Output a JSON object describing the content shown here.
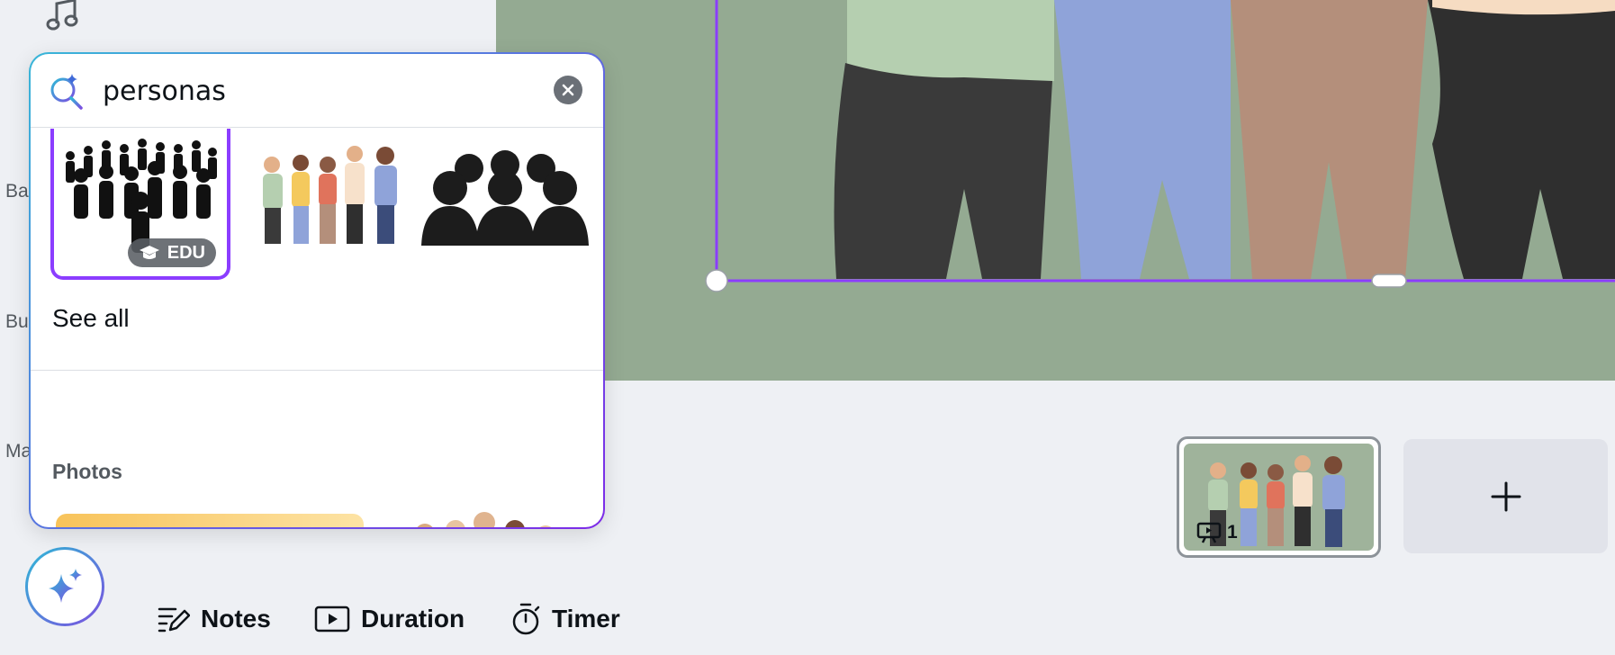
{
  "rail": {
    "labels": [
      "Ba",
      "Bu",
      "Ma"
    ]
  },
  "search": {
    "value": "personas",
    "placeholder": ""
  },
  "results": {
    "graphics_badge": "EDU",
    "see_all": "See all",
    "photos_title": "Photos"
  },
  "filmstrip": {
    "page_number": "1"
  },
  "toolbar": {
    "notes_label": "Notes",
    "duration_label": "Duration",
    "timer_label": "Timer"
  },
  "colors": {
    "canvas_bg": "#94aa92",
    "selection": "#8b3dff",
    "app_bg": "#eef0f4"
  }
}
